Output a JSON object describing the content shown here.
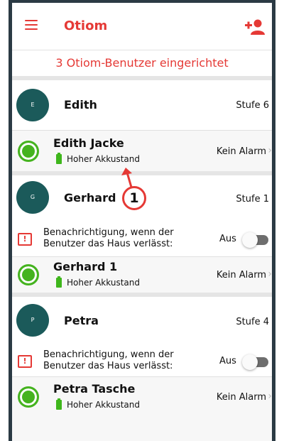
{
  "app": {
    "title": "Otiom",
    "summary": "3 Otiom-Benutzer eingerichtet"
  },
  "colors": {
    "accent": "#e53935",
    "avatar": "#1b5a5a",
    "status_ok": "#45b31f"
  },
  "icons": {
    "menu": "menu-icon",
    "add_user": "add-user-icon",
    "battery": "battery-icon",
    "notice": "alert-icon",
    "chevron": "chevron-right-icon"
  },
  "users": [
    {
      "initial": "E",
      "name": "Edith",
      "level": "Stufe 6",
      "device": {
        "name": "Edith Jacke",
        "battery": "Hoher Akkustand",
        "alarm": "Kein Alarm"
      }
    },
    {
      "initial": "G",
      "name": "Gerhard",
      "level": "Stufe 1",
      "notification": {
        "text": "Benachrichtigung, wenn der Benutzer das Haus verlässt:",
        "state": "Aus"
      },
      "device": {
        "name": "Gerhard 1",
        "battery": "Hoher Akkustand",
        "alarm": "Kein Alarm"
      }
    },
    {
      "initial": "P",
      "name": "Petra",
      "level": "Stufe 4",
      "notification": {
        "text": "Benachrichtigung, wenn der Benutzer das Haus verlässt:",
        "state": "Aus"
      },
      "device": {
        "name": "Petra Tasche",
        "battery": "Hoher Akkustand",
        "alarm": "Kein Alarm"
      }
    }
  ],
  "callout": {
    "number": "1"
  },
  "chevron_glyph": "›"
}
